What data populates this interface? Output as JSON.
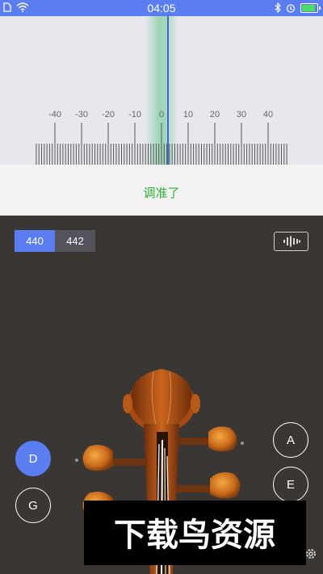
{
  "status_bar": {
    "time": "04:05",
    "battery_level": 0.95
  },
  "tuner": {
    "scale_labels": [
      "-40",
      "-30",
      "-20",
      "-10",
      "0",
      "10",
      "20",
      "30",
      "40"
    ],
    "needle_cents": 2,
    "status_text": "调准了",
    "status_color": "#2fb236",
    "accent_color": "#5b7df2"
  },
  "reference_pitch": {
    "options": [
      "440",
      "442"
    ],
    "selected": "440"
  },
  "waveform_button": {
    "icon": "waveform-icon"
  },
  "strings": {
    "left": [
      {
        "label": "D",
        "selected": true
      },
      {
        "label": "G",
        "selected": false
      }
    ],
    "right": [
      {
        "label": "A",
        "selected": false
      },
      {
        "label": "E",
        "selected": false
      }
    ]
  },
  "watermark": {
    "text": "下载鸟资源"
  }
}
